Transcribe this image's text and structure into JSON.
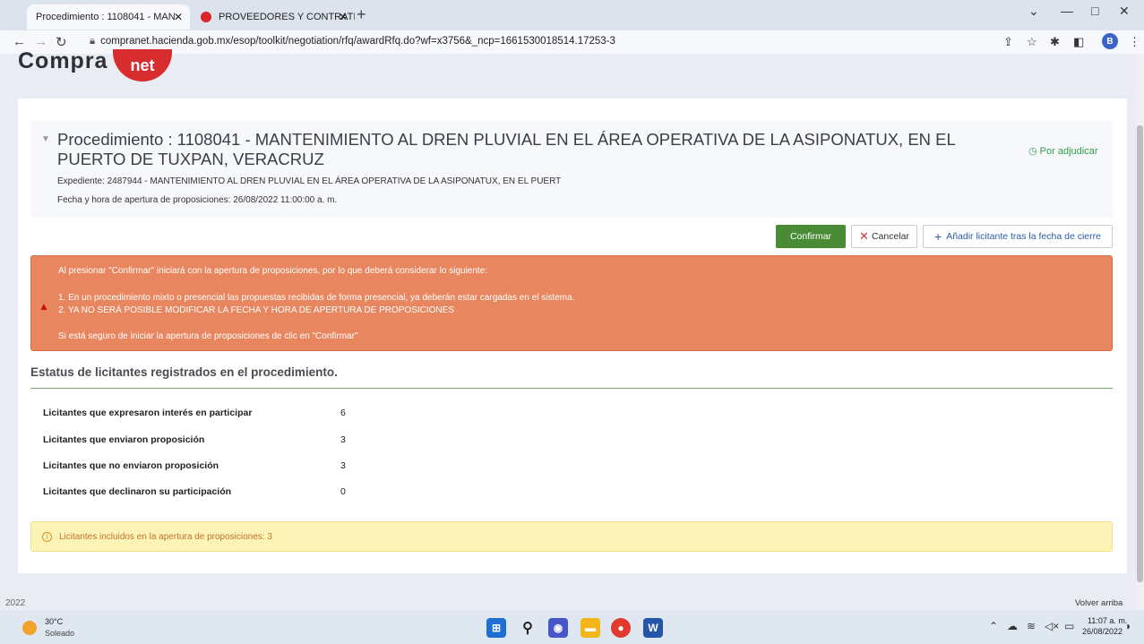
{
  "browser": {
    "tabs": [
      {
        "title": "Procedimiento : 1108041 - MAN",
        "close": "✕"
      },
      {
        "title": "PROVEEDORES Y CONTRATISTAS",
        "close": "✕"
      }
    ],
    "new_tab": "+",
    "url": "compranet.hacienda.gob.mx/esop/toolkit/negotiation/rfq/awardRfq.do?wf=x3756&_ncp=1661530018514.17253-3",
    "profile_initial": "B"
  },
  "site": {
    "logo_text": "Compra",
    "logo_suffix": "net"
  },
  "procedure": {
    "title": "Procedimiento : 1108041 - MANTENIMIENTO AL DREN PLUVIAL EN EL ÁREA OPERATIVA DE LA ASIPONATUX, EN EL PUERTO DE TUXPAN, VERACRUZ",
    "status": "Por adjudicar",
    "expediente": "Expediente: 2487944 - MANTENIMIENTO AL DREN PLUVIAL EN EL ÁREA OPERATIVA DE LA ASIPONATUX, EN EL PUERT",
    "opening": "Fecha y hora de apertura de proposiciones: 26/08/2022 11:00:00 a. m."
  },
  "actions": {
    "confirm": "Confirmar",
    "cancel": "Cancelar",
    "add_bidder": "Añadir licitante tras la fecha de cierre"
  },
  "alert": {
    "intro": "Al presionar \"Confirmar\" iniciará con la apertura de proposiciones, por lo que deberá considerar lo siguiente:",
    "item1": "1. En un procedimiento mixto o presencial las propuestas recibidas de forma presencial, ya deberán estar cargadas en el sistema.",
    "item2": "2. YA NO SERÁ POSIBLE MODIFICAR LA FECHA Y HORA DE APERTURA DE PROPOSICIONES",
    "outro": "Si está seguro de iniciar la apertura de proposiciones de clic en \"Confirmar\""
  },
  "stats": {
    "title": "Estatus de licitantes registrados en el procedimiento.",
    "rows": [
      {
        "label": "Licitantes que expresaron interés en participar",
        "value": "6"
      },
      {
        "label": "Licitantes que enviaron proposición",
        "value": "3"
      },
      {
        "label": "Licitantes que no enviaron proposición",
        "value": "3"
      },
      {
        "label": "Licitantes que declinaron su participación",
        "value": "0"
      }
    ]
  },
  "info": {
    "text": "Licitantes incluidos en la apertura de proposiciones: 3"
  },
  "footer": {
    "year": "2022",
    "back_top": "Volver arriba"
  },
  "taskbar": {
    "temperature": "30°C",
    "condition": "Soleado",
    "time": "11:07 a. m.",
    "date": "26/08/2022"
  },
  "colors": {
    "confirm": "#4a8b36",
    "alert_bg": "#e8875f",
    "status_green": "#2f9e4a",
    "info_bg": "#fcf4b6",
    "logo_red": "#d72d2e"
  }
}
